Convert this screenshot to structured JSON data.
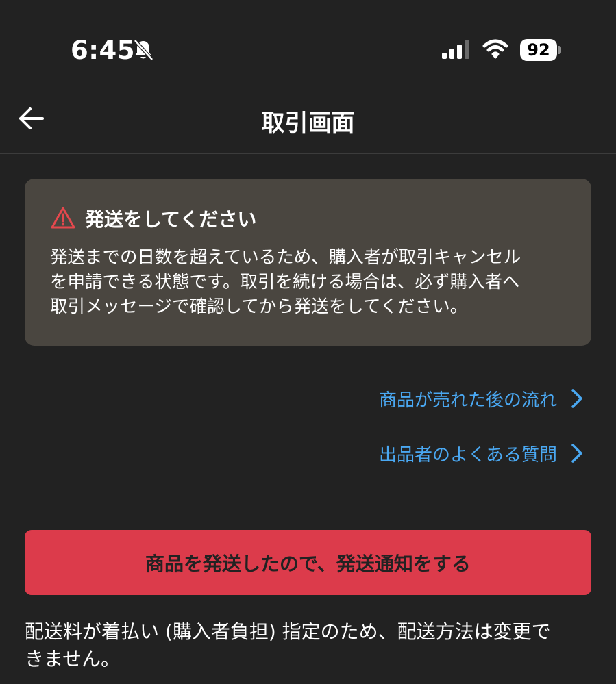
{
  "status_bar": {
    "time": "6:45",
    "battery": "92",
    "icons": [
      "bell-slash-icon",
      "signal-icon",
      "wifi-icon",
      "battery-icon"
    ]
  },
  "nav": {
    "title": "取引画面",
    "back_icon": "arrow-left-icon"
  },
  "notice": {
    "icon": "warning-triangle-icon",
    "title": "発送をしてください",
    "lines": [
      "発送までの日数を超えているため、購入者が取引キャンセル",
      "を申請できる状態です。取引を続ける場合は、必ず購入者へ",
      "取引メッセージで確認してから発送をしてください。"
    ]
  },
  "links": [
    {
      "label": "商品が売れた後の流れ",
      "icon": "chevron-right-icon"
    },
    {
      "label": "出品者のよくある質問",
      "icon": "chevron-right-icon"
    }
  ],
  "primary_button": {
    "label": "商品を発送したので、発送通知をする"
  },
  "shipping_note": {
    "lines": [
      "配送料が着払い (購入者負担) 指定のため、配送方法は変更で",
      "きません。"
    ]
  },
  "colors": {
    "background": "#222222",
    "card": "#4a4640",
    "link": "#4aa8f2",
    "accent": "#dc3b4b",
    "warning_icon": "#e5484d"
  }
}
